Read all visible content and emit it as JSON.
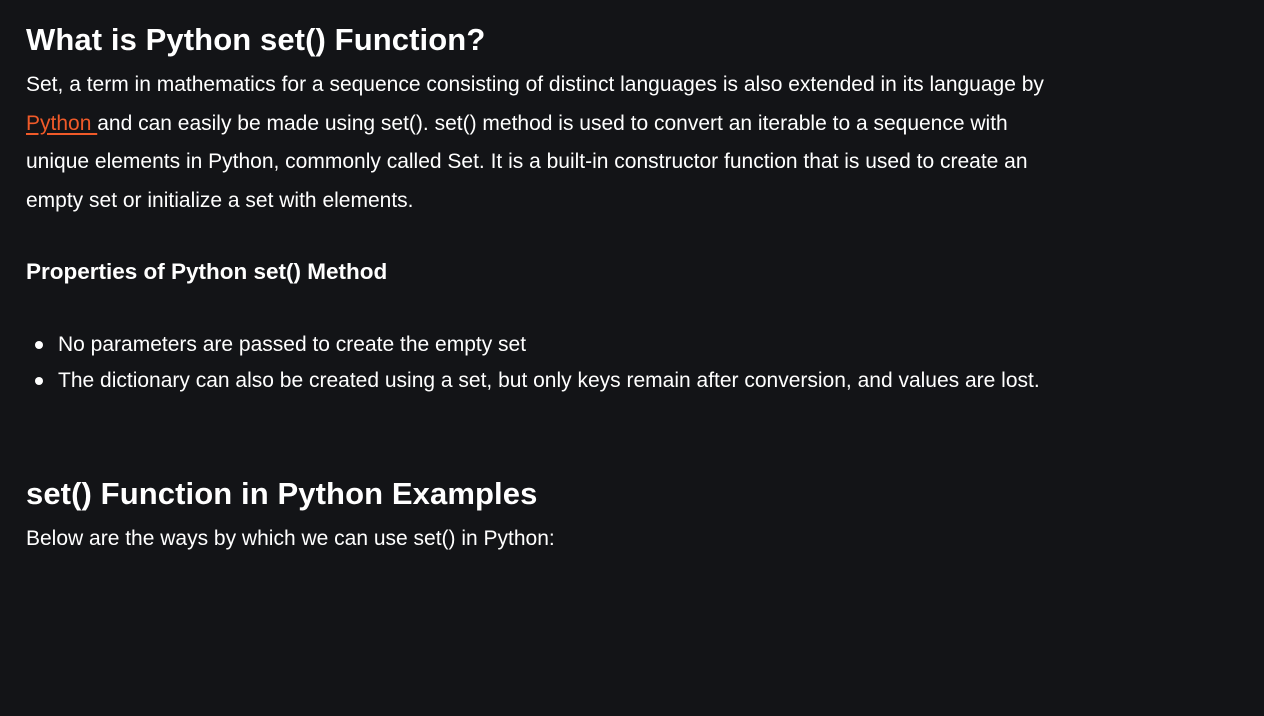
{
  "article": {
    "title": "What is Python set() Function?",
    "intro": {
      "text_before_link": "Set, a term in mathematics for a sequence consisting of distinct languages is also extended in its language by ",
      "link_text": "Python ",
      "text_after_link": "and can easily be made using set(). set() method is used to convert an iterable to a sequence with unique elements in Python, commonly called Set. It is a built-in constructor function that is used to create an empty set or initialize a set with elements."
    },
    "properties": {
      "heading": "Properties of Python set() Method",
      "items": [
        "No parameters are passed to create the empty set",
        "The dictionary can also be created using a set, but only keys remain after conversion, and values are lost."
      ]
    },
    "examples": {
      "heading": "set() Function in Python Examples",
      "intro": "Below are the ways by which we can use set() in Python:"
    }
  },
  "colors": {
    "background": "#131417",
    "text": "#ffffff",
    "link": "#f05a29"
  }
}
